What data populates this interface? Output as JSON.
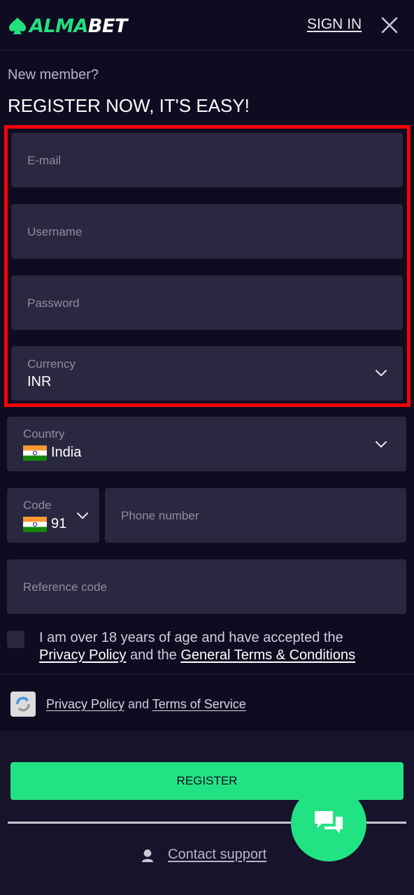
{
  "header": {
    "logo_alma": "ALMA",
    "logo_bet": "BET",
    "sign_in": "SIGN IN"
  },
  "intro": {
    "new_member": "New member?",
    "title": "REGISTER NOW, IT'S EASY!"
  },
  "form": {
    "email_placeholder": "E-mail",
    "username_placeholder": "Username",
    "password_placeholder": "Password",
    "currency_label": "Currency",
    "currency_value": "INR",
    "country_label": "Country",
    "country_value": "India",
    "code_label": "Code",
    "code_value": "91",
    "phone_placeholder": "Phone number",
    "reference_placeholder": "Reference code"
  },
  "terms": {
    "text": "I am over 18 years of age and have accepted the",
    "privacy": "Privacy Policy",
    "and": "and the",
    "general": "General Terms & Conditions"
  },
  "recaptcha": {
    "privacy": "Privacy Policy",
    "and": "and",
    "tos": "Terms of Service"
  },
  "actions": {
    "register": "REGISTER",
    "contact_support": "Contact support"
  },
  "colors": {
    "accent": "#22e384",
    "background": "#0f0c21",
    "field": "#2a2740",
    "highlight": "#ff0000"
  },
  "icons": {
    "logo": "spade-icon",
    "close": "close-icon",
    "chevron": "chevron-down-icon",
    "flag": "india-flag-icon",
    "recaptcha": "recaptcha-icon",
    "support": "agent-icon",
    "chat": "chat-icon"
  }
}
